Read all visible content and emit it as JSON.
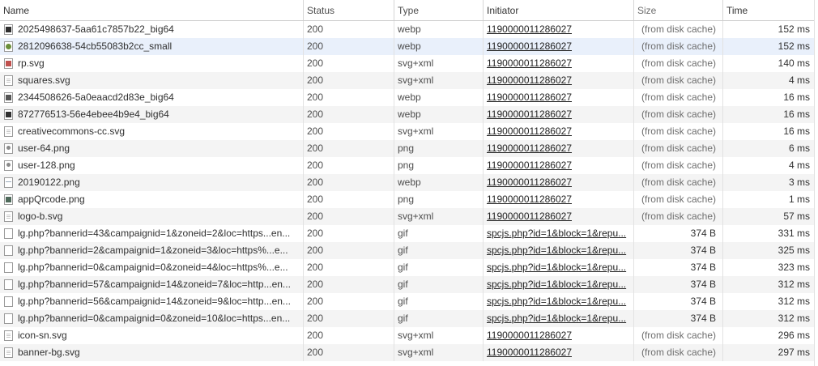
{
  "columns": {
    "name": "Name",
    "status": "Status",
    "type": "Type",
    "initiator": "Initiator",
    "size": "Size",
    "time": "Time"
  },
  "rows": [
    {
      "icon": "image-thumbnail-icon",
      "name": "2025498637-5aa61c7857b22_big64",
      "status": "200",
      "type": "webp",
      "initiator": "1190000011286027",
      "size": "(from disk cache)",
      "time": "152 ms"
    },
    {
      "icon": "image-thumbnail-icon",
      "name": "2812096638-54cb55083b2cc_small",
      "status": "200",
      "type": "webp",
      "initiator": "1190000011286027",
      "size": "(from disk cache)",
      "time": "152 ms"
    },
    {
      "icon": "svg-file-icon",
      "name": "rp.svg",
      "status": "200",
      "type": "svg+xml",
      "initiator": "1190000011286027",
      "size": "(from disk cache)",
      "time": "140 ms"
    },
    {
      "icon": "document-file-icon",
      "name": "squares.svg",
      "status": "200",
      "type": "svg+xml",
      "initiator": "1190000011286027",
      "size": "(from disk cache)",
      "time": "4 ms"
    },
    {
      "icon": "image-thumbnail-icon",
      "name": "2344508626-5a0eaacd2d83e_big64",
      "status": "200",
      "type": "webp",
      "initiator": "1190000011286027",
      "size": "(from disk cache)",
      "time": "16 ms"
    },
    {
      "icon": "image-thumbnail-icon",
      "name": "872776513-56e4ebee4b9e4_big64",
      "status": "200",
      "type": "webp",
      "initiator": "1190000011286027",
      "size": "(from disk cache)",
      "time": "16 ms"
    },
    {
      "icon": "document-file-icon",
      "name": "creativecommons-cc.svg",
      "status": "200",
      "type": "svg+xml",
      "initiator": "1190000011286027",
      "size": "(from disk cache)",
      "time": "16 ms"
    },
    {
      "icon": "user-image-icon",
      "name": "user-64.png",
      "status": "200",
      "type": "png",
      "initiator": "1190000011286027",
      "size": "(from disk cache)",
      "time": "6 ms"
    },
    {
      "icon": "user-image-icon",
      "name": "user-128.png",
      "status": "200",
      "type": "png",
      "initiator": "1190000011286027",
      "size": "(from disk cache)",
      "time": "4 ms"
    },
    {
      "icon": "picture-file-icon",
      "name": "20190122.png",
      "status": "200",
      "type": "webp",
      "initiator": "1190000011286027",
      "size": "(from disk cache)",
      "time": "3 ms"
    },
    {
      "icon": "qr-code-icon",
      "name": "appQrcode.png",
      "status": "200",
      "type": "png",
      "initiator": "1190000011286027",
      "size": "(from disk cache)",
      "time": "1 ms"
    },
    {
      "icon": "document-file-icon",
      "name": "logo-b.svg",
      "status": "200",
      "type": "svg+xml",
      "initiator": "1190000011286027",
      "size": "(from disk cache)",
      "time": "57 ms"
    },
    {
      "icon": "blank-file-icon",
      "name": "lg.php?bannerid=43&campaignid=1&zoneid=2&loc=https...en...",
      "status": "200",
      "type": "gif",
      "initiator": "spcjs.php?id=1&block=1&repu...",
      "size": "374 B",
      "time": "331 ms"
    },
    {
      "icon": "blank-file-icon",
      "name": "lg.php?bannerid=2&campaignid=1&zoneid=3&loc=https%...e...",
      "status": "200",
      "type": "gif",
      "initiator": "spcjs.php?id=1&block=1&repu...",
      "size": "374 B",
      "time": "325 ms"
    },
    {
      "icon": "blank-file-icon",
      "name": "lg.php?bannerid=0&campaignid=0&zoneid=4&loc=https%...e...",
      "status": "200",
      "type": "gif",
      "initiator": "spcjs.php?id=1&block=1&repu...",
      "size": "374 B",
      "time": "323 ms"
    },
    {
      "icon": "blank-file-icon",
      "name": "lg.php?bannerid=57&campaignid=14&zoneid=7&loc=http...en...",
      "status": "200",
      "type": "gif",
      "initiator": "spcjs.php?id=1&block=1&repu...",
      "size": "374 B",
      "time": "312 ms"
    },
    {
      "icon": "blank-file-icon",
      "name": "lg.php?bannerid=56&campaignid=14&zoneid=9&loc=http...en...",
      "status": "200",
      "type": "gif",
      "initiator": "spcjs.php?id=1&block=1&repu...",
      "size": "374 B",
      "time": "312 ms"
    },
    {
      "icon": "blank-file-icon",
      "name": "lg.php?bannerid=0&campaignid=0&zoneid=10&loc=https...en...",
      "status": "200",
      "type": "gif",
      "initiator": "spcjs.php?id=1&block=1&repu...",
      "size": "374 B",
      "time": "312 ms"
    },
    {
      "icon": "document-file-icon",
      "name": "icon-sn.svg",
      "status": "200",
      "type": "svg+xml",
      "initiator": "1190000011286027",
      "size": "(from disk cache)",
      "time": "296 ms"
    },
    {
      "icon": "document-file-icon",
      "name": "banner-bg.svg",
      "status": "200",
      "type": "svg+xml",
      "initiator": "1190000011286027",
      "size": "(from disk cache)",
      "time": "297 ms"
    }
  ]
}
